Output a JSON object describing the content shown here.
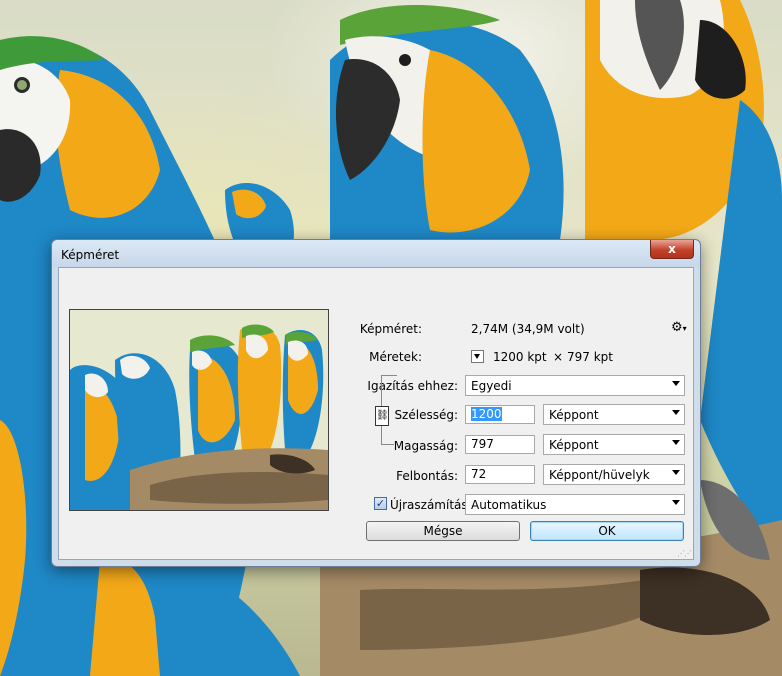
{
  "window": {
    "title": "Képméret",
    "close_label": "x"
  },
  "info": {
    "size_label": "Képméret:",
    "size_value": "2,74M (34,9M volt)",
    "dimensions_label": "Méretek:",
    "dimensions_width": "1200 kpt",
    "dimensions_sep": "×",
    "dimensions_height": "797 kpt"
  },
  "fit": {
    "label": "Igazítás ehhez:",
    "value": "Egyedi"
  },
  "width": {
    "label": "Szélesség:",
    "value": "1200",
    "unit": "Képpont"
  },
  "height": {
    "label": "Magasság:",
    "value": "797",
    "unit": "Képpont"
  },
  "resolution": {
    "label": "Felbontás:",
    "value": "72",
    "unit": "Képpont/hüvelyk"
  },
  "resample": {
    "label": "Újraszámítás:",
    "checked": true,
    "value": "Automatikus"
  },
  "buttons": {
    "cancel": "Mégse",
    "ok": "OK"
  },
  "colors": {
    "parrot_blue": "#1f88c7",
    "parrot_yellow": "#f3a818",
    "selection": "#3399ff"
  }
}
